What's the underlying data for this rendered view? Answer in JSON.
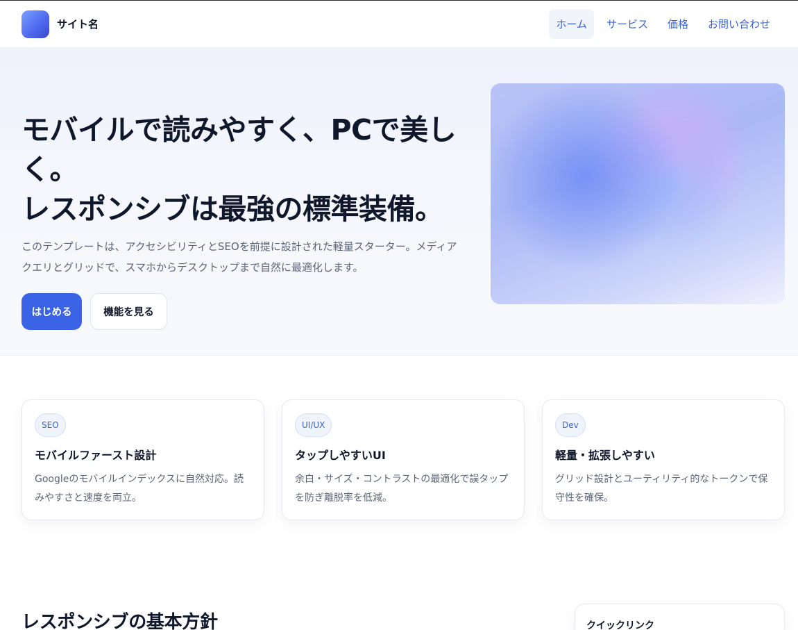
{
  "header": {
    "site_name": "サイト名",
    "nav": [
      "ホーム",
      "サービス",
      "価格",
      "お問い合わせ"
    ],
    "active_nav": "ホーム"
  },
  "hero": {
    "title_line1": "モバイルで読みやすく、PCで美しく。",
    "title_line2": "レスポンシブは最強の標準装備。",
    "description": "このテンプレートは、アクセシビリティとSEOを前提に設計された軽量スターター。メディアクエリとグリッドで、スマホからデスクトップまで自然に最適化します。",
    "primary_button": "はじめる",
    "secondary_button": "機能を見る"
  },
  "features": [
    {
      "badge": "SEO",
      "title": "モバイルファースト設計",
      "text": "Googleのモバイルインデックスに自然対応。読みやすさと速度を両立。"
    },
    {
      "badge": "UI/UX",
      "title": "タップしやすいUI",
      "text": "余白・サイズ・コントラストの最適化で誤タップを防ぎ離脱率を低減。"
    },
    {
      "badge": "Dev",
      "title": "軽量・拡張しやすい",
      "text": "グリッド設計とユーティリティ的なトークンで保守性を確保。"
    }
  ],
  "policy": {
    "title": "レスポンシブの基本方針"
  },
  "sidebar": {
    "quick_links_title": "クイックリンク"
  },
  "colors": {
    "accent": "#3b63e6",
    "nav_link": "#3b63d6",
    "text": "#0f172a",
    "muted": "#5b6577"
  }
}
